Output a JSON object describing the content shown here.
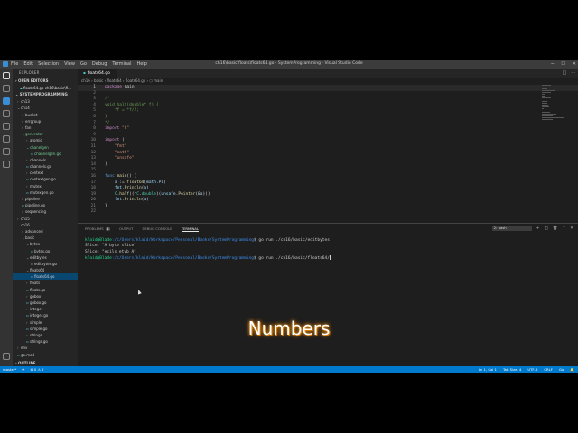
{
  "window": {
    "title": "ch16\\basic\\floats\\floats64.go - SystemProgramming - Visual Studio Code",
    "menu": [
      "File",
      "Edit",
      "Selection",
      "View",
      "Go",
      "Debug",
      "Terminal",
      "Help"
    ]
  },
  "sidebar": {
    "header": "EXPLORER",
    "open_editors": "OPEN EDITORS",
    "open_file": "floats64.go ch16\\basic\\fl...",
    "project": "SYSTEMPROGRAMMING",
    "items": [
      {
        "label": "ch13",
        "indent": 1,
        "tri": "›"
      },
      {
        "label": "ch14",
        "indent": 1,
        "tri": "⌄"
      },
      {
        "label": "bucket",
        "indent": 2,
        "tri": "›"
      },
      {
        "label": "errgroup",
        "indent": 2,
        "tri": "›"
      },
      {
        "label": "fan",
        "indent": 2,
        "tri": "›"
      },
      {
        "label": "generator",
        "indent": 2,
        "tri": "⌄",
        "modified": true
      },
      {
        "label": "atomic",
        "indent": 3,
        "tri": "›"
      },
      {
        "label": "chanelgen",
        "indent": 3,
        "tri": "⌄",
        "modified": true
      },
      {
        "label": "channelgen.go",
        "indent": 4,
        "tri": "",
        "modified": true
      },
      {
        "label": "channels",
        "indent": 3,
        "tri": "›"
      },
      {
        "label": "channels.go",
        "indent": 3,
        "tri": ""
      },
      {
        "label": "context",
        "indent": 3,
        "tri": "›"
      },
      {
        "label": "contextgen.go",
        "indent": 3,
        "tri": ""
      },
      {
        "label": "mutex",
        "indent": 3,
        "tri": "›"
      },
      {
        "label": "mutexgen.go",
        "indent": 3,
        "tri": ""
      },
      {
        "label": "pipeline",
        "indent": 2,
        "tri": "›"
      },
      {
        "label": "pipeline.go",
        "indent": 2,
        "tri": ""
      },
      {
        "label": "sequencing",
        "indent": 2,
        "tri": "›"
      },
      {
        "label": "ch15",
        "indent": 1,
        "tri": "›"
      },
      {
        "label": "ch16",
        "indent": 1,
        "tri": "⌄"
      },
      {
        "label": "advanced",
        "indent": 2,
        "tri": "›"
      },
      {
        "label": "basic",
        "indent": 2,
        "tri": "⌄"
      },
      {
        "label": "bytes",
        "indent": 3,
        "tri": "⌄"
      },
      {
        "label": "bytes.go",
        "indent": 4,
        "tri": ""
      },
      {
        "label": "editbytes",
        "indent": 3,
        "tri": "⌄"
      },
      {
        "label": "editbytes.go",
        "indent": 4,
        "tri": ""
      },
      {
        "label": "floats64",
        "indent": 3,
        "tri": "⌄"
      },
      {
        "label": "floats64.go",
        "indent": 4,
        "tri": "",
        "selected": true
      },
      {
        "label": "floats",
        "indent": 3,
        "tri": "›"
      },
      {
        "label": "floats.go",
        "indent": 3,
        "tri": ""
      },
      {
        "label": "gobox",
        "indent": 3,
        "tri": "›"
      },
      {
        "label": "gobox.go",
        "indent": 3,
        "tri": ""
      },
      {
        "label": "integer",
        "indent": 3,
        "tri": "›"
      },
      {
        "label": "integer.go",
        "indent": 3,
        "tri": ""
      },
      {
        "label": "simple",
        "indent": 3,
        "tri": "›"
      },
      {
        "label": "simple.go",
        "indent": 3,
        "tri": ""
      },
      {
        "label": "strings",
        "indent": 3,
        "tri": "›"
      },
      {
        "label": "strings.go",
        "indent": 3,
        "tri": ""
      },
      {
        "label": "env",
        "indent": 1,
        "tri": "›"
      },
      {
        "label": "go.mod",
        "indent": 1,
        "tri": ""
      }
    ],
    "outline": "OUTLINE"
  },
  "editor": {
    "tab": "floats64.go",
    "breadcrumb": "ch16 › basic › floats64 › floats64.go › ⬡ main",
    "lines": [
      {
        "n": "1",
        "html": "<span class='kw'>package</span> <span class='pl'>main</span>",
        "current": true
      },
      {
        "n": "2",
        "html": ""
      },
      {
        "n": "3",
        "html": "<span class='cm'>/*</span>"
      },
      {
        "n": "4",
        "html": "<span class='cm'>void half(double* f) {</span>"
      },
      {
        "n": "5",
        "html": "<span class='cm'>    *f = *f/2;</span>"
      },
      {
        "n": "6",
        "html": "<span class='cm'>}</span>"
      },
      {
        "n": "7",
        "html": "<span class='cm'>*/</span>"
      },
      {
        "n": "8",
        "html": "<span class='kw'>import</span> <span class='str'>\"C\"</span>"
      },
      {
        "n": "9",
        "html": ""
      },
      {
        "n": "10",
        "html": "<span class='kw'>import</span> <span class='pl'>(</span>"
      },
      {
        "n": "11",
        "html": "    <span class='str'>\"fmt\"</span>"
      },
      {
        "n": "12",
        "html": "    <span class='str'>\"math\"</span>"
      },
      {
        "n": "13",
        "html": "    <span class='str'>\"unsafe\"</span>"
      },
      {
        "n": "14",
        "html": "<span class='pl'>)</span>"
      },
      {
        "n": "15",
        "html": ""
      },
      {
        "n": "16",
        "html": "<span class='kw2'>func</span> <span class='fn'>main</span><span class='pl'>() {</span>"
      },
      {
        "n": "17",
        "html": "    <span class='id'>a</span> <span class='pl'>:=</span> <span class='fn'>float64</span><span class='pl'>(</span><span class='id'>math</span><span class='pl'>.</span><span class='id'>Pi</span><span class='pl'>)</span>"
      },
      {
        "n": "18",
        "html": "    <span class='id'>fmt</span><span class='pl'>.</span><span class='fn'>Println</span><span class='pl'>(</span><span class='id'>a</span><span class='pl'>)</span>"
      },
      {
        "n": "19",
        "html": "    <span class='ty'>C</span><span class='pl'>.</span><span class='fn'>half</span><span class='pl'>((*</span><span class='ty'>C</span><span class='pl'>.</span><span class='ty'>double</span><span class='pl'>)(</span><span class='id'>unsafe</span><span class='pl'>.</span><span class='fn'>Pointer</span><span class='pl'>(&amp;</span><span class='id'>a</span><span class='pl'>)))</span>"
      },
      {
        "n": "20",
        "html": "    <span class='id'>fmt</span><span class='pl'>.</span><span class='fn'>Println</span><span class='pl'>(</span><span class='id'>a</span><span class='pl'>)</span>"
      },
      {
        "n": "21",
        "html": "<span class='pl'>}</span>"
      },
      {
        "n": "22",
        "html": ""
      }
    ]
  },
  "panel": {
    "tabs": {
      "problems": "PROBLEMS",
      "problems_count": "2",
      "output": "OUTPUT",
      "debug": "DEBUG CONSOLE",
      "terminal": "TERMINAL"
    },
    "shell": "2: bash",
    "terminal": [
      {
        "user": "klaid@Blade",
        "path": ":/c/Users/klaid/Workspace/Personal/Books/SystemProgramming",
        "cmd": "$ go run ./ch16/basic/editbytes"
      },
      {
        "text": "Slice: \"A byte slice\""
      },
      {
        "text": "Slice: \"ecils etyb A\""
      },
      {
        "user": "klaid@Blade",
        "path": ":/c/Users/klaid/Workspace/Personal/Books/SystemProgramming",
        "cmd": "$ go run ./ch16/basic/floats64/",
        "cursor": true
      }
    ]
  },
  "statusbar": {
    "branch": "master*",
    "sync": "⟳",
    "errors": "⊗ 0 ⚠ 2",
    "position": "Ln 1, Col 1",
    "tabsize": "Tab Size: 4",
    "encoding": "UTF-8",
    "eol": "CRLF",
    "language": "Go",
    "bell": "🔔"
  },
  "caption": "Numbers"
}
